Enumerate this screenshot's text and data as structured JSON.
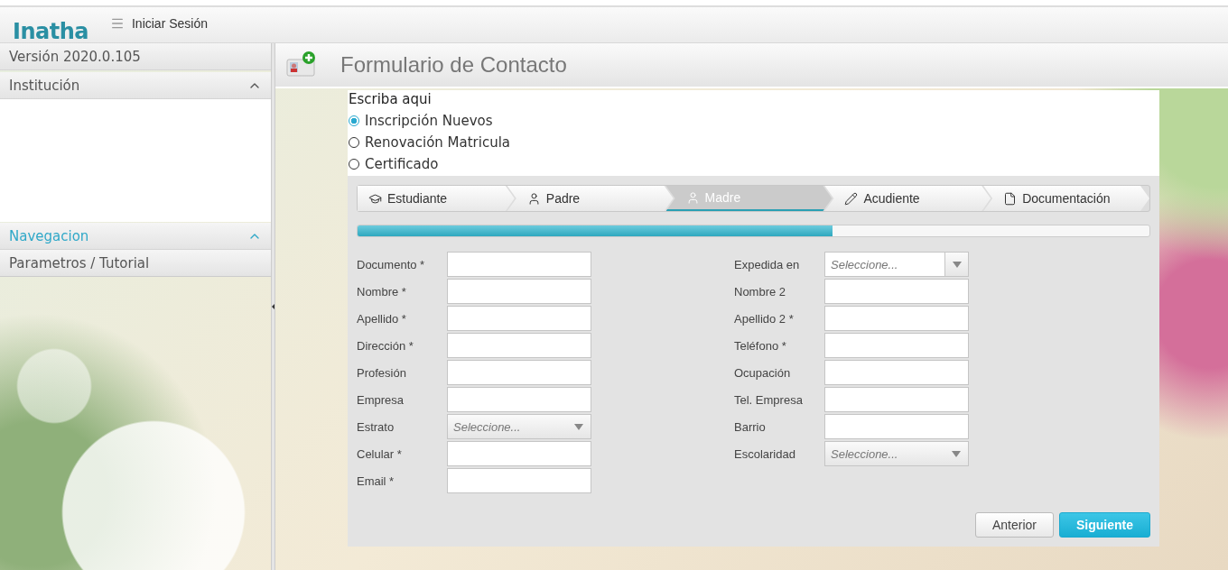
{
  "topbar": {
    "logo": "Inatha",
    "login": "Iniciar Sesión"
  },
  "sidebar": {
    "version": "Versión 2020.0.105",
    "sections": [
      {
        "title": "Institución",
        "expanded": true,
        "active": false
      },
      {
        "title": "Navegacion",
        "expanded": true,
        "active": true,
        "items": [
          "Parametros / Tutorial"
        ]
      }
    ]
  },
  "page": {
    "title": "Formulario de Contacto"
  },
  "form": {
    "prompt": "Escriba aqui",
    "options": [
      {
        "label": "Inscripción Nuevos",
        "selected": true
      },
      {
        "label": "Renovación Matricula",
        "selected": false
      },
      {
        "label": "Certificado",
        "selected": false
      }
    ],
    "steps": [
      {
        "label": "Estudiante",
        "kind": "student",
        "selected": false
      },
      {
        "label": "Padre",
        "kind": "person",
        "selected": false
      },
      {
        "label": "Madre",
        "kind": "person",
        "selected": true
      },
      {
        "label": "Acudiente",
        "kind": "pencil",
        "selected": false
      },
      {
        "label": "Documentación",
        "kind": "document",
        "selected": false
      }
    ],
    "progress": {
      "level": 0.6
    },
    "left_fields": [
      {
        "label": "Documento *",
        "kind": "text"
      },
      {
        "label": "Nombre *",
        "kind": "text"
      },
      {
        "label": "Apellido *",
        "kind": "text"
      },
      {
        "label": "Dirección *",
        "kind": "text"
      },
      {
        "label": "Profesión",
        "kind": "text"
      },
      {
        "label": "Empresa",
        "kind": "text"
      },
      {
        "label": "Estrato",
        "kind": "select",
        "placeholder": "Seleccione..."
      },
      {
        "label": "Celular *",
        "kind": "text"
      },
      {
        "label": "Email *",
        "kind": "text"
      }
    ],
    "right_fields": [
      {
        "label": "Expedida en",
        "kind": "combo",
        "placeholder": "Seleccione..."
      },
      {
        "label": "Nombre 2",
        "kind": "text"
      },
      {
        "label": "Apellido 2 *",
        "kind": "text"
      },
      {
        "label": "Teléfono *",
        "kind": "text"
      },
      {
        "label": "Ocupación",
        "kind": "text"
      },
      {
        "label": "Tel. Empresa",
        "kind": "text"
      },
      {
        "label": "Barrio",
        "kind": "text"
      },
      {
        "label": "Escolaridad",
        "kind": "select",
        "placeholder": "Seleccione..."
      }
    ],
    "buttons": [
      {
        "label": "Anterior",
        "kind": "default"
      },
      {
        "label": "Siguiente",
        "kind": "primary"
      }
    ]
  }
}
